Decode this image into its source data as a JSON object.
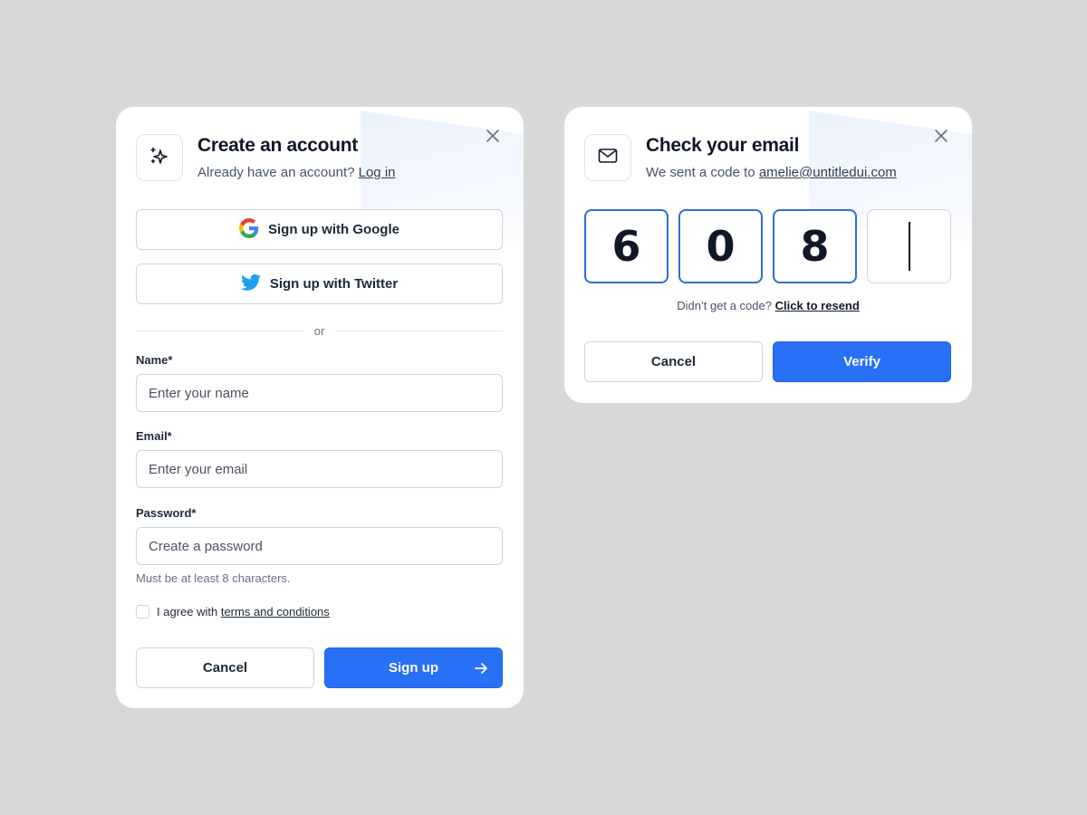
{
  "signup_modal": {
    "title": "Create an account",
    "subtitle_prefix": "Already have an account?",
    "login_link": "Log in",
    "google_label": "Sign up with Google",
    "twitter_label": "Sign up with Twitter",
    "divider_text": "or",
    "fields": {
      "name": {
        "label": "Name*",
        "placeholder": "Enter your name",
        "value": ""
      },
      "email": {
        "label": "Email*",
        "placeholder": "Enter your email",
        "value": ""
      },
      "password": {
        "label": "Password*",
        "placeholder": "Create a password",
        "value": ""
      }
    },
    "password_hint": "Must be at least 8 characters.",
    "agree_prefix": "I agree with",
    "terms_link": "terms and conditions",
    "agree_checked": false,
    "cancel_label": "Cancel",
    "submit_label": "Sign up",
    "icons": {
      "header": "sparkle-icon",
      "close": "close-icon",
      "google": "google-logo-icon",
      "twitter": "twitter-logo-icon",
      "submit": "arrow-right-icon"
    }
  },
  "verify_modal": {
    "title": "Check your email",
    "subtitle_prefix": "We sent a code to",
    "email": "amelie@untitledui.com",
    "code_digits": [
      "6",
      "0",
      "8",
      ""
    ],
    "resend_prefix": "Didn’t get a code?",
    "resend_link": "Click to resend",
    "cancel_label": "Cancel",
    "verify_label": "Verify",
    "icons": {
      "header": "mail-icon",
      "close": "close-icon"
    }
  },
  "colors": {
    "background": "#d8d8d8",
    "primary": "#2870f6",
    "code_border_active": "#2f6fd0",
    "text_dark": "#101828"
  }
}
